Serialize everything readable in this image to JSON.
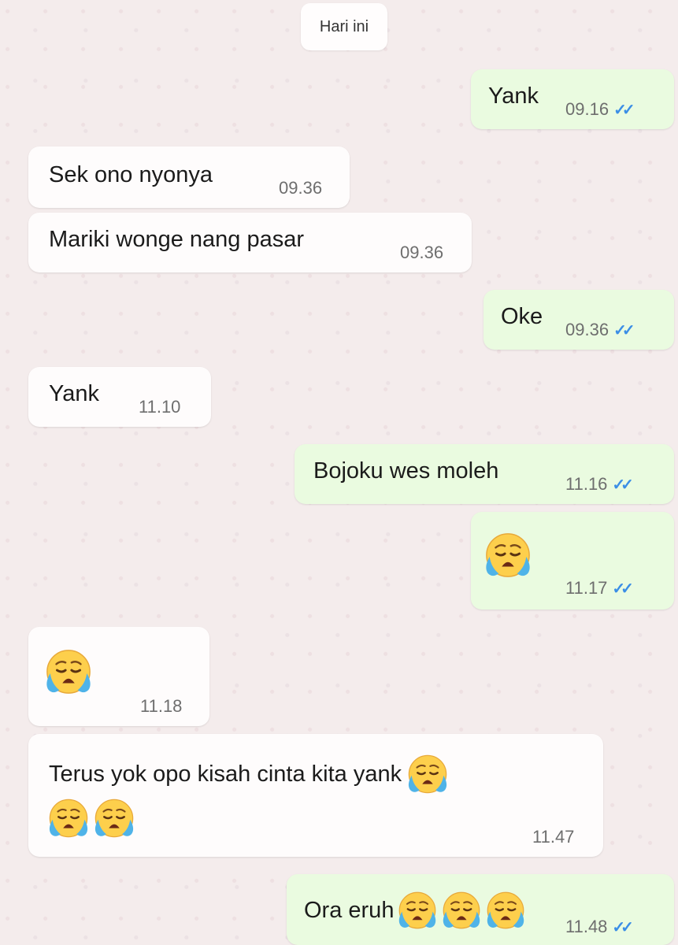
{
  "date_chip": "Hari ini",
  "messages": [
    {
      "text": "Yank",
      "time": "09.16",
      "ticks": "✓✓"
    },
    {
      "text": "Sek ono nyonya",
      "time": "09.36"
    },
    {
      "text": "Mariki wonge nang pasar",
      "time": "09.36"
    },
    {
      "text": "Oke",
      "time": "09.36",
      "ticks": "✓✓"
    },
    {
      "text": "Yank",
      "time": "11.10"
    },
    {
      "text": "Bojoku wes moleh",
      "time": "11.16",
      "ticks": "✓✓"
    },
    {
      "emoji": "loudly-crying-face-icon",
      "time": "11.17",
      "ticks": "✓✓"
    },
    {
      "emoji": "loudly-crying-face-icon",
      "time": "11.18"
    },
    {
      "text": "Terus yok opo kisah cinta kita yank",
      "time": "11.47"
    },
    {
      "text": "Ora eruh",
      "time": "11.48",
      "ticks": "✓✓"
    }
  ],
  "colors": {
    "incoming": "#fefcfc",
    "outgoing": "#eafbe0",
    "ticks": "#3b8ee6",
    "background": "#f4ecec"
  }
}
